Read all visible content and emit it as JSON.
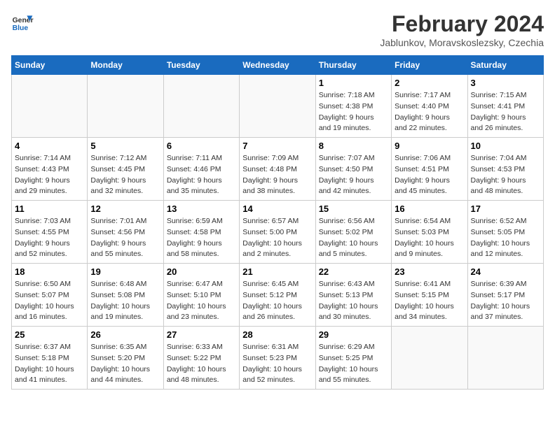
{
  "logo": {
    "line1": "General",
    "line2": "Blue"
  },
  "title": "February 2024",
  "subtitle": "Jablunkov, Moravskoslezsky, Czechia",
  "days_of_week": [
    "Sunday",
    "Monday",
    "Tuesday",
    "Wednesday",
    "Thursday",
    "Friday",
    "Saturday"
  ],
  "weeks": [
    [
      {
        "day": "",
        "info": ""
      },
      {
        "day": "",
        "info": ""
      },
      {
        "day": "",
        "info": ""
      },
      {
        "day": "",
        "info": ""
      },
      {
        "day": "1",
        "info": "Sunrise: 7:18 AM\nSunset: 4:38 PM\nDaylight: 9 hours\nand 19 minutes."
      },
      {
        "day": "2",
        "info": "Sunrise: 7:17 AM\nSunset: 4:40 PM\nDaylight: 9 hours\nand 22 minutes."
      },
      {
        "day": "3",
        "info": "Sunrise: 7:15 AM\nSunset: 4:41 PM\nDaylight: 9 hours\nand 26 minutes."
      }
    ],
    [
      {
        "day": "4",
        "info": "Sunrise: 7:14 AM\nSunset: 4:43 PM\nDaylight: 9 hours\nand 29 minutes."
      },
      {
        "day": "5",
        "info": "Sunrise: 7:12 AM\nSunset: 4:45 PM\nDaylight: 9 hours\nand 32 minutes."
      },
      {
        "day": "6",
        "info": "Sunrise: 7:11 AM\nSunset: 4:46 PM\nDaylight: 9 hours\nand 35 minutes."
      },
      {
        "day": "7",
        "info": "Sunrise: 7:09 AM\nSunset: 4:48 PM\nDaylight: 9 hours\nand 38 minutes."
      },
      {
        "day": "8",
        "info": "Sunrise: 7:07 AM\nSunset: 4:50 PM\nDaylight: 9 hours\nand 42 minutes."
      },
      {
        "day": "9",
        "info": "Sunrise: 7:06 AM\nSunset: 4:51 PM\nDaylight: 9 hours\nand 45 minutes."
      },
      {
        "day": "10",
        "info": "Sunrise: 7:04 AM\nSunset: 4:53 PM\nDaylight: 9 hours\nand 48 minutes."
      }
    ],
    [
      {
        "day": "11",
        "info": "Sunrise: 7:03 AM\nSunset: 4:55 PM\nDaylight: 9 hours\nand 52 minutes."
      },
      {
        "day": "12",
        "info": "Sunrise: 7:01 AM\nSunset: 4:56 PM\nDaylight: 9 hours\nand 55 minutes."
      },
      {
        "day": "13",
        "info": "Sunrise: 6:59 AM\nSunset: 4:58 PM\nDaylight: 9 hours\nand 58 minutes."
      },
      {
        "day": "14",
        "info": "Sunrise: 6:57 AM\nSunset: 5:00 PM\nDaylight: 10 hours\nand 2 minutes."
      },
      {
        "day": "15",
        "info": "Sunrise: 6:56 AM\nSunset: 5:02 PM\nDaylight: 10 hours\nand 5 minutes."
      },
      {
        "day": "16",
        "info": "Sunrise: 6:54 AM\nSunset: 5:03 PM\nDaylight: 10 hours\nand 9 minutes."
      },
      {
        "day": "17",
        "info": "Sunrise: 6:52 AM\nSunset: 5:05 PM\nDaylight: 10 hours\nand 12 minutes."
      }
    ],
    [
      {
        "day": "18",
        "info": "Sunrise: 6:50 AM\nSunset: 5:07 PM\nDaylight: 10 hours\nand 16 minutes."
      },
      {
        "day": "19",
        "info": "Sunrise: 6:48 AM\nSunset: 5:08 PM\nDaylight: 10 hours\nand 19 minutes."
      },
      {
        "day": "20",
        "info": "Sunrise: 6:47 AM\nSunset: 5:10 PM\nDaylight: 10 hours\nand 23 minutes."
      },
      {
        "day": "21",
        "info": "Sunrise: 6:45 AM\nSunset: 5:12 PM\nDaylight: 10 hours\nand 26 minutes."
      },
      {
        "day": "22",
        "info": "Sunrise: 6:43 AM\nSunset: 5:13 PM\nDaylight: 10 hours\nand 30 minutes."
      },
      {
        "day": "23",
        "info": "Sunrise: 6:41 AM\nSunset: 5:15 PM\nDaylight: 10 hours\nand 34 minutes."
      },
      {
        "day": "24",
        "info": "Sunrise: 6:39 AM\nSunset: 5:17 PM\nDaylight: 10 hours\nand 37 minutes."
      }
    ],
    [
      {
        "day": "25",
        "info": "Sunrise: 6:37 AM\nSunset: 5:18 PM\nDaylight: 10 hours\nand 41 minutes."
      },
      {
        "day": "26",
        "info": "Sunrise: 6:35 AM\nSunset: 5:20 PM\nDaylight: 10 hours\nand 44 minutes."
      },
      {
        "day": "27",
        "info": "Sunrise: 6:33 AM\nSunset: 5:22 PM\nDaylight: 10 hours\nand 48 minutes."
      },
      {
        "day": "28",
        "info": "Sunrise: 6:31 AM\nSunset: 5:23 PM\nDaylight: 10 hours\nand 52 minutes."
      },
      {
        "day": "29",
        "info": "Sunrise: 6:29 AM\nSunset: 5:25 PM\nDaylight: 10 hours\nand 55 minutes."
      },
      {
        "day": "",
        "info": ""
      },
      {
        "day": "",
        "info": ""
      }
    ]
  ]
}
